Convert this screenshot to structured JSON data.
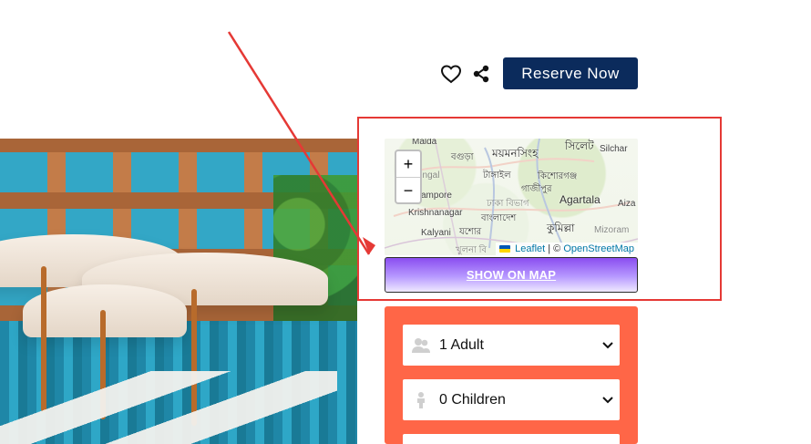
{
  "actions": {
    "reserve_label": "Reserve Now",
    "heart_icon": "heart-outline",
    "share_icon": "share"
  },
  "map": {
    "zoom_in_label": "+",
    "zoom_out_label": "−",
    "labels": [
      "Malda",
      "বগুড়া",
      "ময়মনসিংহ",
      "সিলেট",
      "Silchar",
      "engal",
      "টাঙ্গাইল",
      "গাজীপুর",
      "কিশোরগঞ্জ",
      "ampore",
      "ঢাকা বিভাগ",
      "Agartala",
      "Aiza",
      "Krishnanagar",
      "বাংলাদেশ",
      "কুমিল্লা",
      "Mizoram",
      "Kalyani",
      "যশোর",
      "খুলনা বি"
    ],
    "attribution": {
      "leaflet": "Leaflet",
      "separator": "| ©",
      "osm": "OpenStreetMap"
    }
  },
  "show_map_label": "SHOW ON MAP",
  "booking": {
    "adults_value": "1 Adult",
    "children_value": "0 Children"
  },
  "colors": {
    "navy": "#0b2b5c",
    "booking_panel": "#ff6647",
    "annotation_red": "#e53935",
    "show_map_top": "#8a4df0"
  }
}
